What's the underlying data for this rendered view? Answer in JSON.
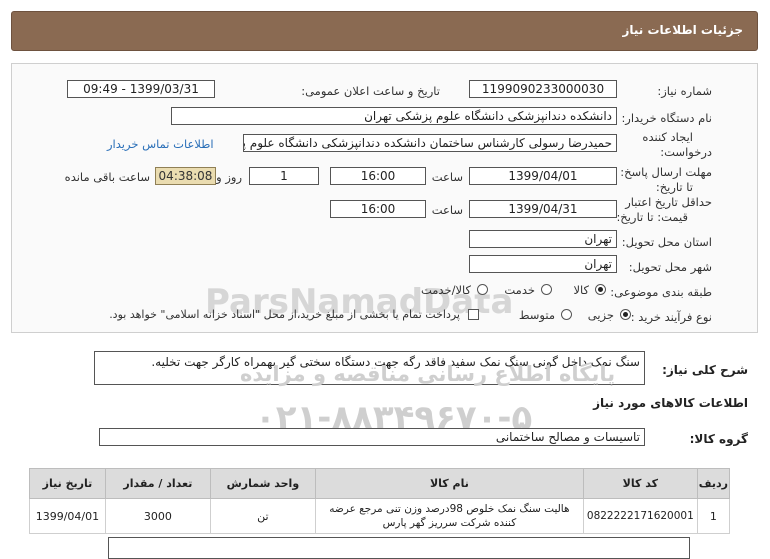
{
  "header": {
    "title": "جزئیات اطلاعات نیاز"
  },
  "form": {
    "need_number_label": "شماره نیاز:",
    "need_number": "1199090233000030",
    "announce_label": "تاریخ و ساعت اعلان عمومی:",
    "announce_value": "1399/03/31 - 09:49",
    "buyer_label": "نام دستگاه خریدار:",
    "buyer_value": "دانشکده دندانپزشکی دانشگاه علوم پزشکی تهران",
    "creator_label_1": "ایجاد کننده",
    "creator_label_2": "درخواست:",
    "creator_value": "حمیدرضا رسولی کارشناس ساختمان دانشکده دندانپزشکی دانشگاه علوم پزشکی تهران",
    "contact_link": "اطلاعات تماس خریدار",
    "deadline_label_1": "مهلت ارسال پاسخ:",
    "deadline_label_2": "تا تاریخ:",
    "deadline_date": "1399/04/01",
    "time_label": "ساعت",
    "deadline_time": "16:00",
    "days_value": "1",
    "days_label": "روز و",
    "remaining_value": "04:38:08",
    "remaining_label": "ساعت باقی مانده",
    "validity_label_1": "حداقل تاریخ اعتبار",
    "validity_label_2": "قیمت: تا تاریخ:",
    "validity_date": "1399/04/31",
    "validity_time": "16:00",
    "province_label": "استان محل تحویل:",
    "province_value": "تهران",
    "city_label": "شهر محل تحویل:",
    "city_value": "تهران",
    "category_label": "طبقه بندی موضوعی:",
    "category_options": [
      "کالا",
      "خدمت",
      "کالا/خدمت"
    ],
    "process_label": "نوع فرآیند خرید :",
    "process_options": [
      "جزیی",
      "متوسط"
    ],
    "payment_text": "پرداخت تمام یا بخشی از مبلغ خرید،از محل \"اسناد خزانه اسلامی\" خواهد بود."
  },
  "description": {
    "label": "شرح کلی نیاز:",
    "value": "سنگ نمک داخل گونی سنگ نمک سفید فاقد رگه  جهت دستگاه سختی گیر بهمراه کارگر جهت تخلیه."
  },
  "goods": {
    "section_title": "اطلاعات کالاهای مورد نیاز",
    "group_label": "گروه کالا:",
    "group_value": "تاسیسات و مصالح ساختمانی",
    "columns": [
      "ردیف",
      "کد کالا",
      "نام کالا",
      "واحد شمارش",
      "تعداد / مقدار",
      "تاریخ نیاز"
    ],
    "rows": [
      {
        "row": "1",
        "code": "0822222171620001",
        "name": "هالیت سنگ نمک خلوص 98درصد وزن تنی مرجع عرضه کننده شرکت سرریز گهر پارس",
        "unit": "تن",
        "qty": "3000",
        "date": "1399/04/01"
      }
    ]
  },
  "watermark": {
    "brand": "ParsNamadData",
    "line1": "پایگاه اطلاع رسانی مناقصه و مزایده",
    "phone": "۰۲۱-۸۸۳۴۹۶۷۰-۵"
  }
}
